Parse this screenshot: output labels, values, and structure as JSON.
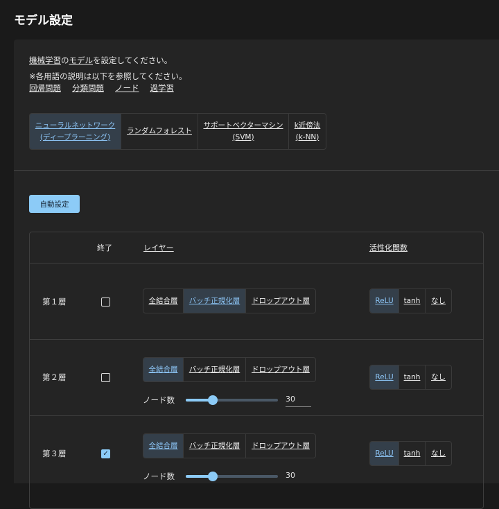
{
  "title": "モデル設定",
  "intro": {
    "line1_link1": "機械学習",
    "line1_mid": "の",
    "line1_link2": "モデル",
    "line1_end": "を設定してください。",
    "line2": "※各用語の説明は以下を参照してください。",
    "links": [
      "回帰問題",
      "分類問題",
      "ノード",
      "過学習"
    ]
  },
  "models": [
    {
      "l1": "ニューラルネットワーク",
      "l2": "(ディープラーニング)"
    },
    {
      "l1": "ランダムフォレスト",
      "l2": ""
    },
    {
      "l1": "サポートベクターマシン",
      "l2": "(SVM)"
    },
    {
      "l1": "k近傍法",
      "l2": "(k-NN)"
    }
  ],
  "auto_button": "自動設定",
  "headers": {
    "end": "終了",
    "layer": "レイヤー",
    "activation": "活性化関数"
  },
  "layer_types": [
    "全結合層",
    "バッチ正規化層",
    "ドロップアウト層"
  ],
  "activations": [
    "ReLU",
    "tanh",
    "なし"
  ],
  "node_label": "ノード数",
  "rows": [
    {
      "label": "第１層",
      "end": false,
      "layer": 1,
      "activation": 0
    },
    {
      "label": "第２層",
      "end": false,
      "layer": 0,
      "activation": 0,
      "nodes": "30",
      "node_fraction": 0.29
    },
    {
      "label": "第３層",
      "end": true,
      "layer": 0,
      "activation": 0,
      "nodes": "30",
      "node_fraction": 0.29
    }
  ]
}
